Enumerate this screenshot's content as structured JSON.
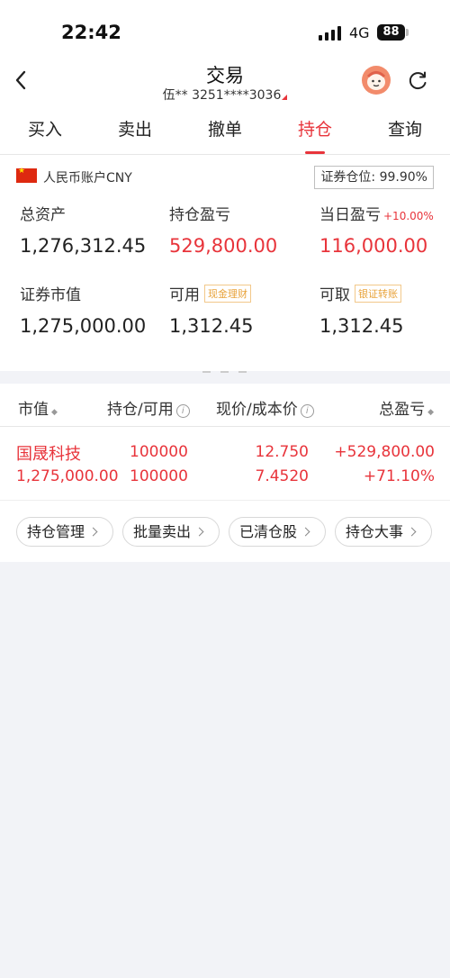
{
  "status": {
    "time": "22:42",
    "network": "4G",
    "battery": "88"
  },
  "nav": {
    "title": "交易",
    "account": "伍** 3251****3036"
  },
  "tabs": [
    "买入",
    "卖出",
    "撤单",
    "持仓",
    "查询"
  ],
  "active_tab": "持仓",
  "account": {
    "currency_label": "人民币账户CNY",
    "position_ratio": "证券仓位: 99.90%",
    "total_assets_label": "总资产",
    "total_assets": "1,276,312.45",
    "position_pnl_label": "持仓盈亏",
    "position_pnl": "529,800.00",
    "day_pnl_label": "当日盈亏",
    "day_pnl_pct": "+10.00%",
    "day_pnl": "116,000.00",
    "market_value_label": "证券市值",
    "market_value": "1,275,000.00",
    "available_label": "可用",
    "available_chip": "现金理财",
    "available": "1,312.45",
    "withdrawable_label": "可取",
    "withdrawable_chip": "银证转账",
    "withdrawable": "1,312.45"
  },
  "table": {
    "headers": {
      "market_value": "市值",
      "holding": "持仓/可用",
      "price": "现价/成本价",
      "total_pnl": "总盈亏"
    },
    "rows": [
      {
        "name": "国晟科技",
        "market_value": "1,275,000.00",
        "holding": "100000",
        "available": "100000",
        "price": "12.750",
        "cost": "7.4520",
        "pnl": "+529,800.00",
        "pnl_pct": "+71.10%"
      }
    ]
  },
  "actions": [
    "持仓管理",
    "批量卖出",
    "已清仓股",
    "持仓大事"
  ],
  "colors": {
    "accent": "#e8343b",
    "chip": "#e8a33b",
    "background": "#f2f3f7"
  }
}
